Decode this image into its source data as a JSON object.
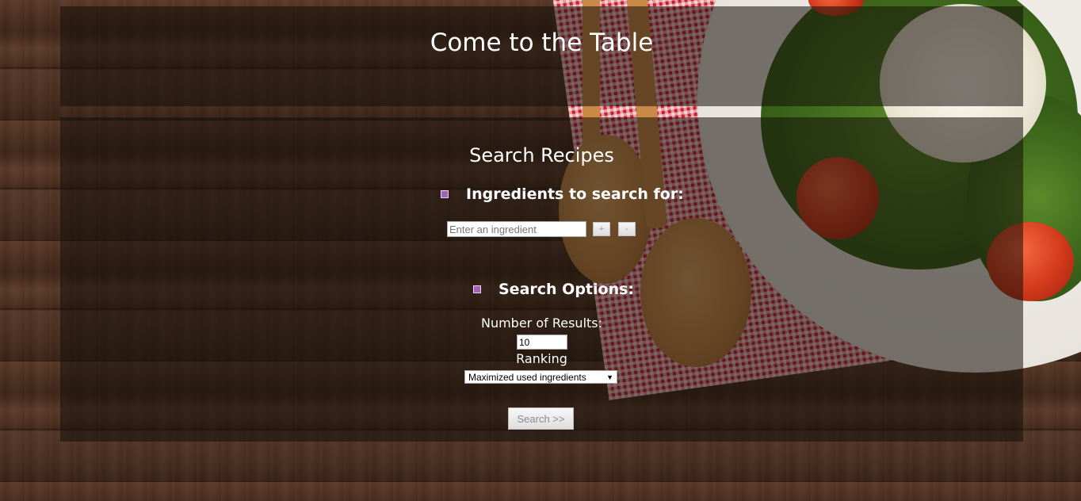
{
  "header": {
    "title": "Come to the Table"
  },
  "search": {
    "section_title": "Search Recipes",
    "ingredients_heading": "Ingredients to search for:",
    "ingredient_placeholder": "Enter an ingredient",
    "add_label": "+",
    "remove_label": "-",
    "options_heading": "Search Options:",
    "results_label": "Number of Results:",
    "results_value": "10",
    "ranking_label": "Ranking",
    "ranking_selected": "Maximized used ingredients",
    "submit_label": "Search >>"
  },
  "colors": {
    "bullet": "#a063b8",
    "panel_overlay": "rgba(20,14,10,0.55)",
    "text": "#ffffff"
  },
  "icons": {
    "dropdown": "chevron-down-icon",
    "bullet": "square-bullet-icon"
  }
}
